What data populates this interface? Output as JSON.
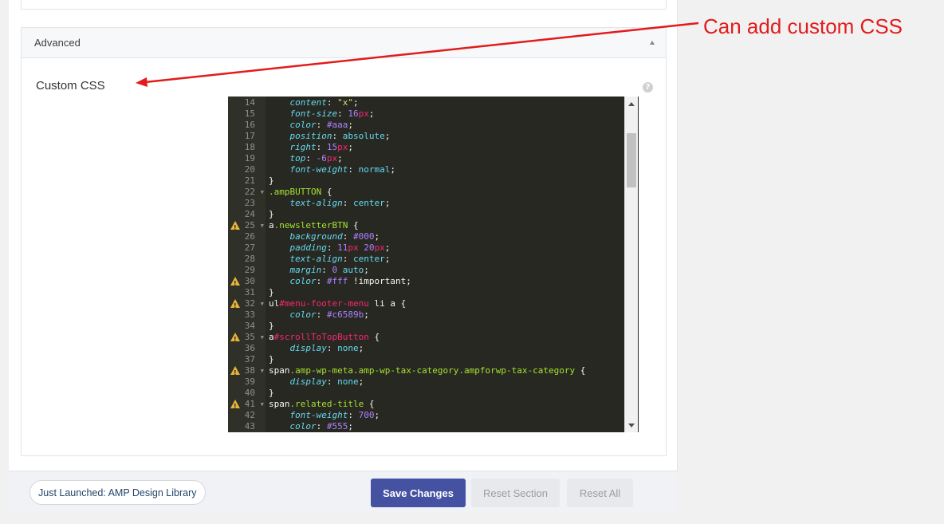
{
  "section": {
    "title": "Advanced"
  },
  "field": {
    "label": "Custom CSS",
    "help": "?"
  },
  "editor": {
    "lines": [
      {
        "n": "14",
        "warn": false,
        "fold": false,
        "tokens": [
          [
            "",
            "    "
          ],
          [
            "prop",
            "content"
          ],
          [
            "",
            ": "
          ],
          [
            "str",
            "\"x\""
          ],
          [
            "",
            ";"
          ]
        ]
      },
      {
        "n": "15",
        "warn": false,
        "fold": false,
        "tokens": [
          [
            "",
            "    "
          ],
          [
            "prop",
            "font-size"
          ],
          [
            "",
            ": "
          ],
          [
            "num",
            "16"
          ],
          [
            "unit",
            "px"
          ],
          [
            "",
            ";"
          ]
        ]
      },
      {
        "n": "16",
        "warn": false,
        "fold": false,
        "tokens": [
          [
            "",
            "    "
          ],
          [
            "prop",
            "color"
          ],
          [
            "",
            ": "
          ],
          [
            "num",
            "#aaa"
          ],
          [
            "",
            ";"
          ]
        ]
      },
      {
        "n": "17",
        "warn": false,
        "fold": false,
        "tokens": [
          [
            "",
            "    "
          ],
          [
            "prop",
            "position"
          ],
          [
            "",
            ": "
          ],
          [
            "kw",
            "absolute"
          ],
          [
            "",
            ";"
          ]
        ]
      },
      {
        "n": "18",
        "warn": false,
        "fold": false,
        "tokens": [
          [
            "",
            "    "
          ],
          [
            "prop",
            "right"
          ],
          [
            "",
            ": "
          ],
          [
            "num",
            "15"
          ],
          [
            "unit",
            "px"
          ],
          [
            "",
            ";"
          ]
        ]
      },
      {
        "n": "19",
        "warn": false,
        "fold": false,
        "tokens": [
          [
            "",
            "    "
          ],
          [
            "prop",
            "top"
          ],
          [
            "",
            ": "
          ],
          [
            "num",
            "-6"
          ],
          [
            "unit",
            "px"
          ],
          [
            "",
            ";"
          ]
        ]
      },
      {
        "n": "20",
        "warn": false,
        "fold": false,
        "tokens": [
          [
            "",
            "    "
          ],
          [
            "prop",
            "font-weight"
          ],
          [
            "",
            ": "
          ],
          [
            "kw",
            "normal"
          ],
          [
            "",
            ";"
          ]
        ]
      },
      {
        "n": "21",
        "warn": false,
        "fold": false,
        "tokens": [
          [
            "",
            "}"
          ]
        ]
      },
      {
        "n": "22",
        "warn": false,
        "fold": true,
        "tokens": [
          [
            "cls",
            ".ampBUTTON"
          ],
          [
            "",
            " {"
          ]
        ]
      },
      {
        "n": "23",
        "warn": false,
        "fold": false,
        "tokens": [
          [
            "",
            "    "
          ],
          [
            "prop",
            "text-align"
          ],
          [
            "",
            ": "
          ],
          [
            "kw",
            "center"
          ],
          [
            "",
            ";"
          ]
        ]
      },
      {
        "n": "24",
        "warn": false,
        "fold": false,
        "tokens": [
          [
            "",
            "}"
          ]
        ]
      },
      {
        "n": "25",
        "warn": true,
        "fold": true,
        "tokens": [
          [
            "",
            "a"
          ],
          [
            "cls",
            ".newsletterBTN"
          ],
          [
            "",
            " {"
          ]
        ]
      },
      {
        "n": "26",
        "warn": false,
        "fold": false,
        "tokens": [
          [
            "",
            "    "
          ],
          [
            "prop",
            "background"
          ],
          [
            "",
            ": "
          ],
          [
            "num",
            "#000"
          ],
          [
            "",
            ";"
          ]
        ]
      },
      {
        "n": "27",
        "warn": false,
        "fold": false,
        "tokens": [
          [
            "",
            "    "
          ],
          [
            "prop",
            "padding"
          ],
          [
            "",
            ": "
          ],
          [
            "num",
            "11"
          ],
          [
            "unit",
            "px"
          ],
          [
            "",
            " "
          ],
          [
            "num",
            "20"
          ],
          [
            "unit",
            "px"
          ],
          [
            "",
            ";"
          ]
        ]
      },
      {
        "n": "28",
        "warn": false,
        "fold": false,
        "tokens": [
          [
            "",
            "    "
          ],
          [
            "prop",
            "text-align"
          ],
          [
            "",
            ": "
          ],
          [
            "kw",
            "center"
          ],
          [
            "",
            ";"
          ]
        ]
      },
      {
        "n": "29",
        "warn": false,
        "fold": false,
        "tokens": [
          [
            "",
            "    "
          ],
          [
            "prop",
            "margin"
          ],
          [
            "",
            ": "
          ],
          [
            "num",
            "0"
          ],
          [
            "",
            " "
          ],
          [
            "kw",
            "auto"
          ],
          [
            "",
            ";"
          ]
        ]
      },
      {
        "n": "30",
        "warn": true,
        "fold": false,
        "tokens": [
          [
            "",
            "    "
          ],
          [
            "prop",
            "color"
          ],
          [
            "",
            ": "
          ],
          [
            "num",
            "#fff"
          ],
          [
            "",
            " !important;"
          ]
        ]
      },
      {
        "n": "31",
        "warn": false,
        "fold": false,
        "tokens": [
          [
            "",
            "}"
          ]
        ]
      },
      {
        "n": "32",
        "warn": true,
        "fold": true,
        "tokens": [
          [
            "",
            "ul"
          ],
          [
            "idp",
            "#menu-footer-menu"
          ],
          [
            "",
            " li a {"
          ]
        ]
      },
      {
        "n": "33",
        "warn": false,
        "fold": false,
        "tokens": [
          [
            "",
            "    "
          ],
          [
            "prop",
            "color"
          ],
          [
            "",
            ": "
          ],
          [
            "num",
            "#c6589b"
          ],
          [
            "",
            ";"
          ]
        ]
      },
      {
        "n": "34",
        "warn": false,
        "fold": false,
        "tokens": [
          [
            "",
            "}"
          ]
        ]
      },
      {
        "n": "35",
        "warn": true,
        "fold": true,
        "tokens": [
          [
            "",
            "a"
          ],
          [
            "idp",
            "#scrollToTopButton"
          ],
          [
            "",
            " {"
          ]
        ]
      },
      {
        "n": "36",
        "warn": false,
        "fold": false,
        "tokens": [
          [
            "",
            "    "
          ],
          [
            "prop",
            "display"
          ],
          [
            "",
            ": "
          ],
          [
            "kw",
            "none"
          ],
          [
            "",
            ";"
          ]
        ]
      },
      {
        "n": "37",
        "warn": false,
        "fold": false,
        "tokens": [
          [
            "",
            "}"
          ]
        ]
      },
      {
        "n": "38",
        "warn": true,
        "fold": true,
        "tokens": [
          [
            "",
            "span"
          ],
          [
            "cls",
            ".amp-wp-meta.amp-wp-tax-category.ampforwp-tax-category"
          ],
          [
            "",
            " {"
          ]
        ]
      },
      {
        "n": "39",
        "warn": false,
        "fold": false,
        "tokens": [
          [
            "",
            "    "
          ],
          [
            "prop",
            "display"
          ],
          [
            "",
            ": "
          ],
          [
            "kw",
            "none"
          ],
          [
            "",
            ";"
          ]
        ]
      },
      {
        "n": "40",
        "warn": false,
        "fold": false,
        "tokens": [
          [
            "",
            "}"
          ]
        ]
      },
      {
        "n": "41",
        "warn": true,
        "fold": true,
        "tokens": [
          [
            "",
            "span"
          ],
          [
            "cls",
            ".related-title"
          ],
          [
            "",
            " {"
          ]
        ]
      },
      {
        "n": "42",
        "warn": false,
        "fold": false,
        "tokens": [
          [
            "",
            "    "
          ],
          [
            "prop",
            "font-weight"
          ],
          [
            "",
            ": "
          ],
          [
            "num",
            "700"
          ],
          [
            "",
            ";"
          ]
        ]
      },
      {
        "n": "43",
        "warn": false,
        "fold": false,
        "tokens": [
          [
            "",
            "    "
          ],
          [
            "prop",
            "color"
          ],
          [
            "",
            ": "
          ],
          [
            "num",
            "#555"
          ],
          [
            "",
            ";"
          ]
        ]
      }
    ]
  },
  "footer": {
    "launch_badge": "Just Launched: AMP Design Library",
    "save_label": "Save Changes",
    "reset_section_label": "Reset Section",
    "reset_all_label": "Reset All"
  },
  "annotation": {
    "text": "Can add custom CSS",
    "color": "#e21b1b"
  },
  "colors": {
    "accent": "#4452a1",
    "editor_bg": "#272822",
    "warning": "#e8b43a"
  },
  "icons": {
    "collapse": "chevron-up-icon",
    "help": "question-circle-icon",
    "warning": "warning-triangle-icon",
    "fold": "fold-arrow-icon"
  }
}
